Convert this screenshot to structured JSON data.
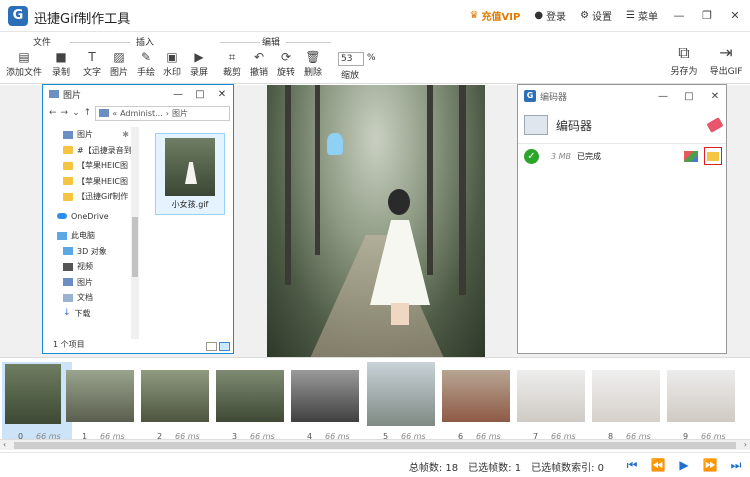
{
  "app": {
    "title": "迅捷Gif制作工具",
    "vip_label": "充值VIP",
    "login_label": "登录",
    "settings_label": "设置",
    "menu_label": "菜单"
  },
  "toolbar": {
    "file_group": "文件",
    "insert_group": "插入",
    "edit_group": "编辑",
    "add_file": "添加文件",
    "record": "录制",
    "text": "文字",
    "image": "图片",
    "freehand": "手绘",
    "watermark": "水印",
    "screen_record": "录屏",
    "crop": "裁剪",
    "undo": "撤销",
    "rotate": "旋转",
    "delete": "删除",
    "zoom_value": "53",
    "zoom_unit": "%",
    "zoom_label": "缩放",
    "save_as": "另存为",
    "export_gif": "导出GIF"
  },
  "explorer": {
    "title": "图片",
    "address_prefix": "«",
    "address_part1": "Administ...",
    "address_sep": "›",
    "address_part2": "图片",
    "tree": [
      {
        "label": "图片",
        "icon": "image-folder-icon",
        "pinned": true
      },
      {
        "label": "#【迅捷录音到",
        "icon": "folder-icon"
      },
      {
        "label": "【苹果HEIC图",
        "icon": "folder-icon"
      },
      {
        "label": "【苹果HEIC图",
        "icon": "folder-icon"
      },
      {
        "label": "【迅捷Gif制作",
        "icon": "folder-icon"
      },
      {
        "label": "OneDrive",
        "icon": "onedrive-icon"
      },
      {
        "label": "此电脑",
        "icon": "pc-icon"
      },
      {
        "label": "3D 对象",
        "icon": "3d-objects-icon"
      },
      {
        "label": "视频",
        "icon": "video-icon"
      },
      {
        "label": "图片",
        "icon": "image-folder-icon"
      },
      {
        "label": "文档",
        "icon": "document-icon"
      },
      {
        "label": "下载",
        "icon": "download-icon"
      }
    ],
    "file_name": "小女孩.gif",
    "status": "1 个项目"
  },
  "encoder": {
    "title": "编码器",
    "header_label": "编码器",
    "row_size": "3 MB",
    "row_status": "已完成"
  },
  "frames": [
    {
      "num": "0",
      "ms": "66 ms"
    },
    {
      "num": "1",
      "ms": "66 ms"
    },
    {
      "num": "2",
      "ms": "66 ms"
    },
    {
      "num": "3",
      "ms": "66 ms"
    },
    {
      "num": "4",
      "ms": "66 ms"
    },
    {
      "num": "5",
      "ms": "66 ms"
    },
    {
      "num": "6",
      "ms": "66 ms"
    },
    {
      "num": "7",
      "ms": "66 ms"
    },
    {
      "num": "8",
      "ms": "66 ms"
    },
    {
      "num": "9",
      "ms": "66 ms"
    }
  ],
  "status": {
    "total_frames": "总帧数: 18",
    "selected_frames": "已选帧数: 1",
    "selected_index": "已选帧数索引: 0"
  }
}
